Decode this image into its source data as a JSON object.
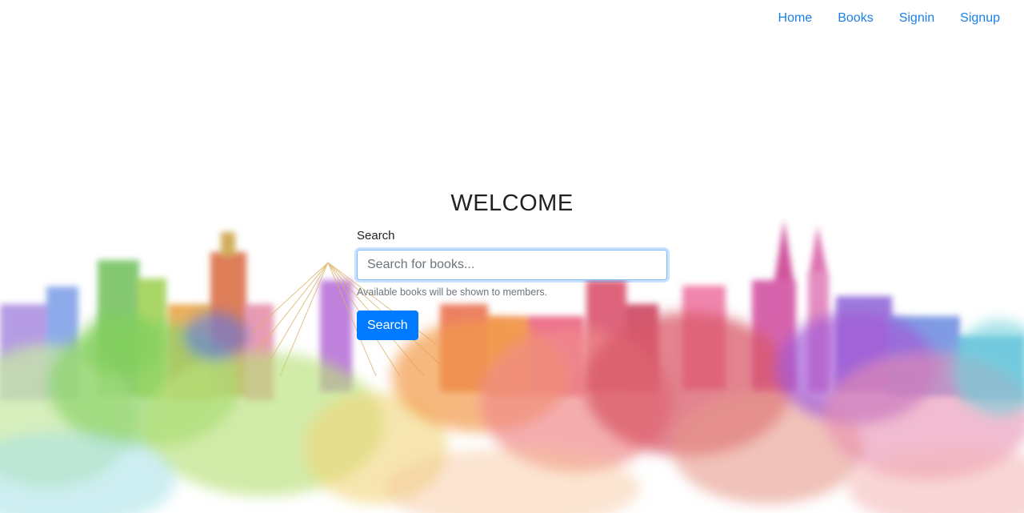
{
  "nav": {
    "items": [
      {
        "label": "Home"
      },
      {
        "label": "Books"
      },
      {
        "label": "Signin"
      },
      {
        "label": "Signup"
      }
    ]
  },
  "main": {
    "title": "WELCOME",
    "search_label": "Search",
    "search_placeholder": "Search for books...",
    "search_value": "",
    "help_text": "Available books will be shown to members.",
    "search_button": "Search"
  },
  "colors": {
    "link": "#1a7fe8",
    "button": "#007bff"
  }
}
